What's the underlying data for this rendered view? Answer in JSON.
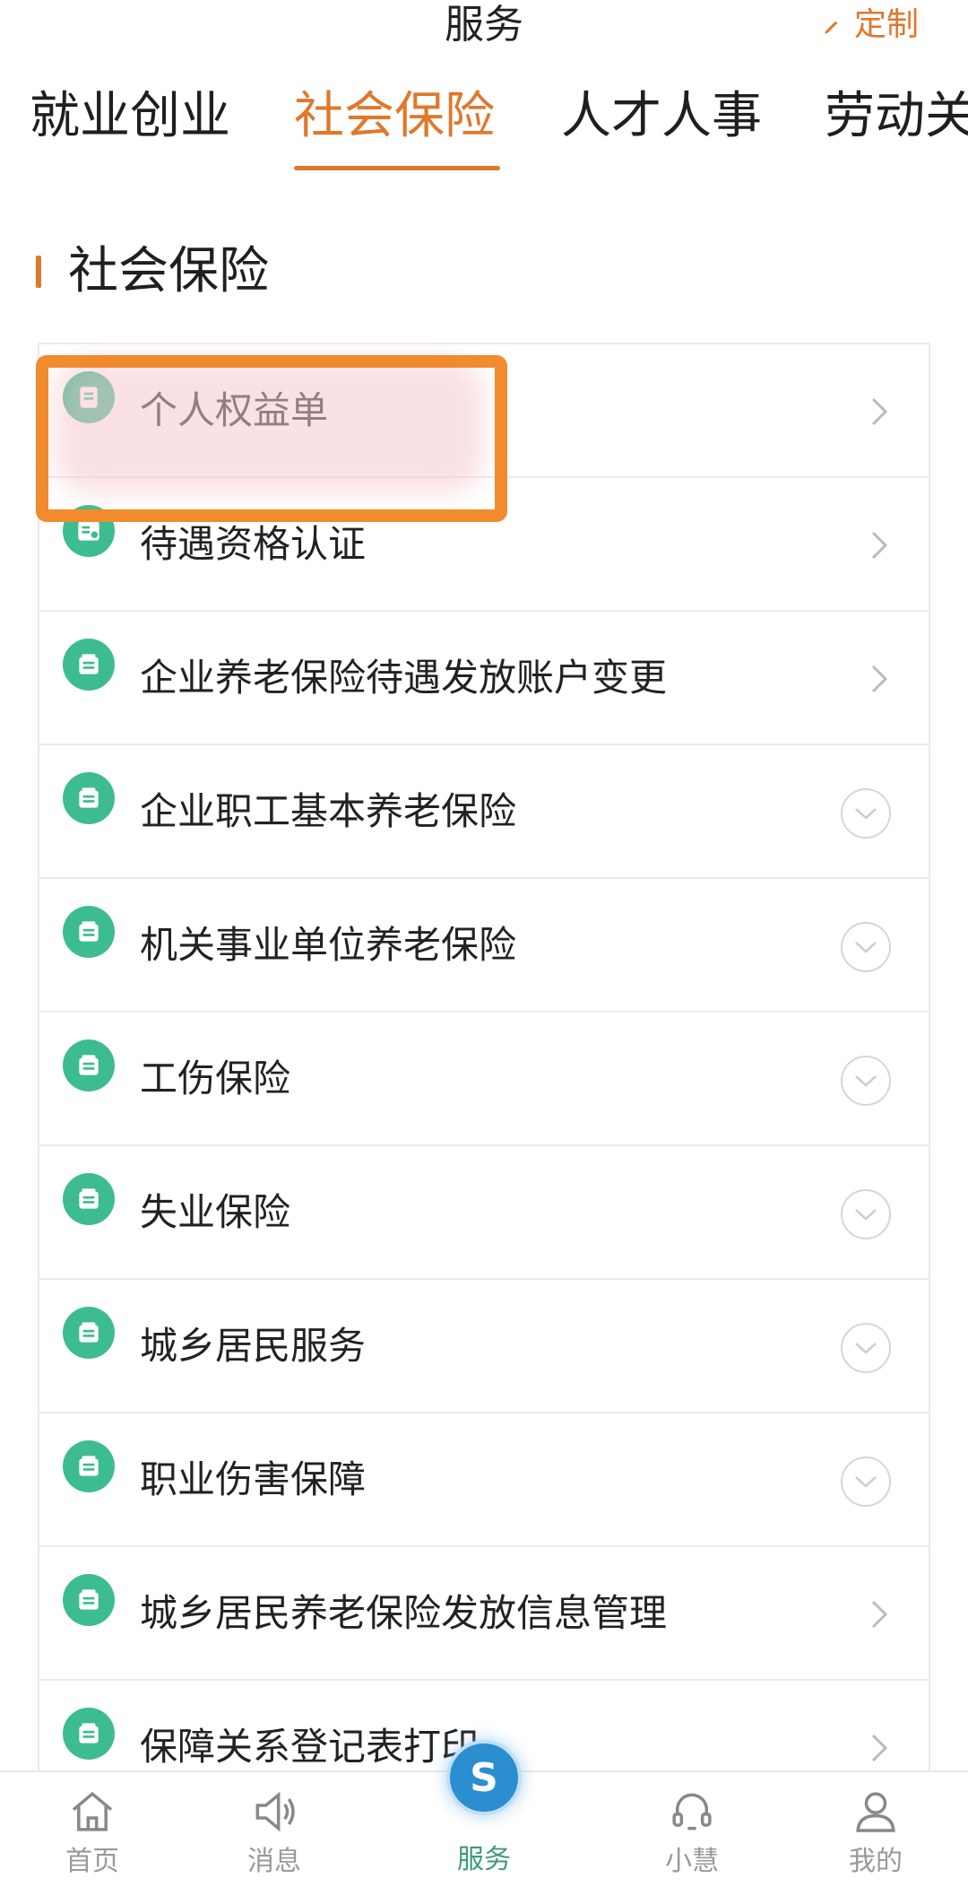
{
  "header": {
    "title": "服务",
    "customize_label": "定制"
  },
  "tabs": [
    {
      "label": "就业创业",
      "active": false
    },
    {
      "label": "社会保险",
      "active": true
    },
    {
      "label": "人才人事",
      "active": false
    },
    {
      "label": "劳动关",
      "active": false
    }
  ],
  "section": {
    "title": "社会保险"
  },
  "items": [
    {
      "label": "个人权益单",
      "trailing": "arrow",
      "icon": "document-icon"
    },
    {
      "label": "待遇资格认证",
      "trailing": "arrow",
      "icon": "certificate-icon"
    },
    {
      "label": "企业养老保险待遇发放账户变更",
      "trailing": "arrow",
      "icon": "box-icon"
    },
    {
      "label": "企业职工基本养老保险",
      "trailing": "expand",
      "icon": "box-icon"
    },
    {
      "label": "机关事业单位养老保险",
      "trailing": "expand",
      "icon": "box-icon"
    },
    {
      "label": "工伤保险",
      "trailing": "expand",
      "icon": "box-icon"
    },
    {
      "label": "失业保险",
      "trailing": "expand",
      "icon": "box-icon"
    },
    {
      "label": "城乡居民服务",
      "trailing": "expand",
      "icon": "box-icon"
    },
    {
      "label": "职业伤害保障",
      "trailing": "expand",
      "icon": "box-icon"
    },
    {
      "label": "城乡居民养老保险发放信息管理",
      "trailing": "arrow",
      "icon": "box-icon"
    },
    {
      "label": "保障关系登记表打印",
      "trailing": "arrow",
      "icon": "box-icon"
    }
  ],
  "bottom_nav": [
    {
      "label": "首页",
      "icon": "home-icon",
      "active": false
    },
    {
      "label": "消息",
      "icon": "speaker-icon",
      "active": false
    },
    {
      "label": "服务",
      "icon": "service-logo-icon",
      "active": true
    },
    {
      "label": "小慧",
      "icon": "headset-icon",
      "active": false
    },
    {
      "label": "我的",
      "icon": "user-icon",
      "active": false
    }
  ],
  "colors": {
    "accent": "#e0782c",
    "icon_green": "#3dbc8f",
    "highlight": "#f28a2e",
    "nav_active": "#3d9a7a"
  }
}
